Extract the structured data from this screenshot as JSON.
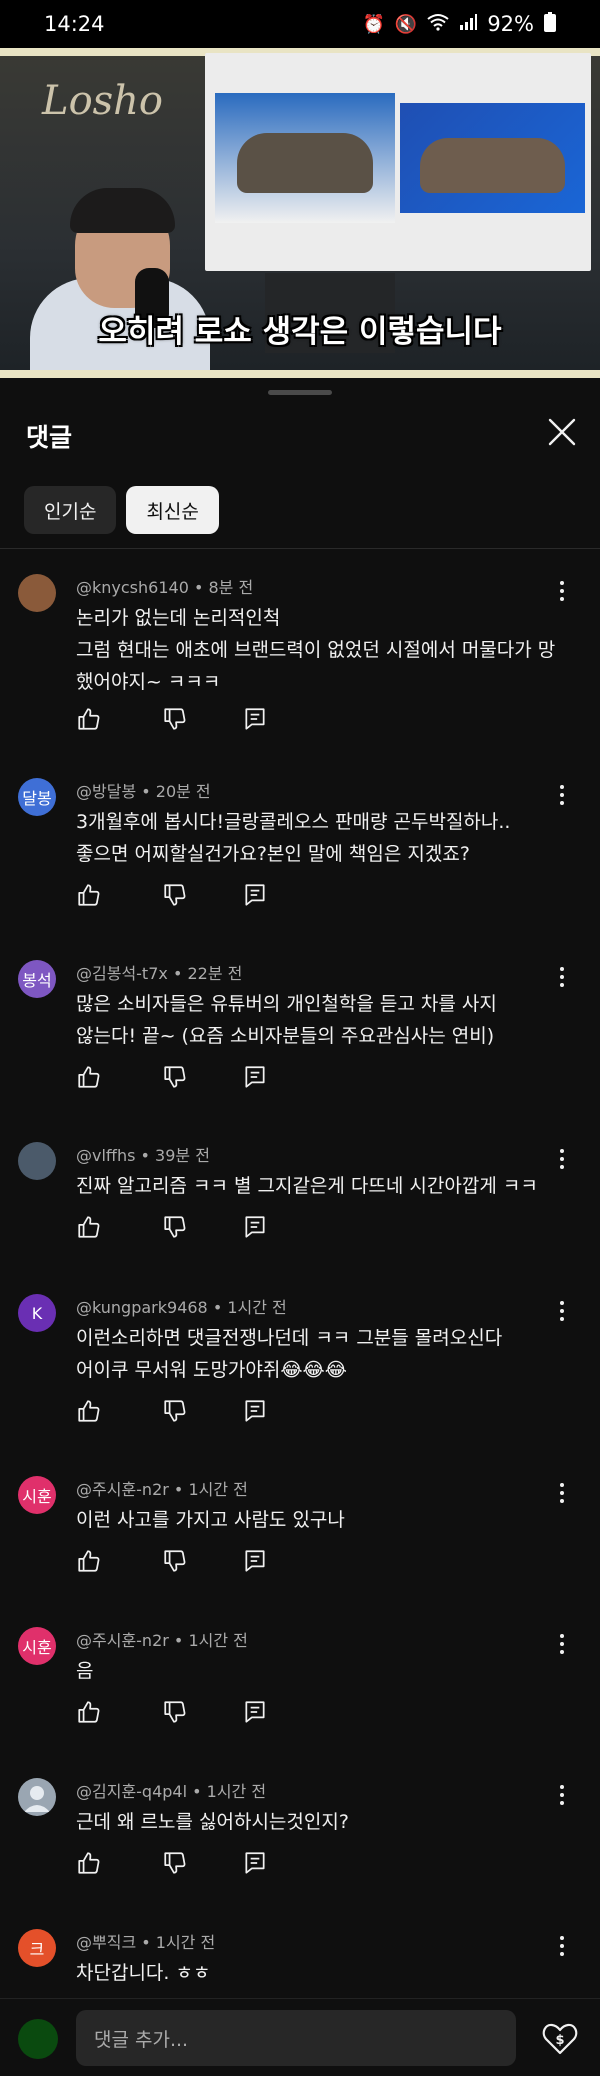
{
  "status": {
    "time": "14:24",
    "battery": "92%"
  },
  "video": {
    "logo": "Losho",
    "caption": "오히려 로쇼 생각은 이렇습니다"
  },
  "sheet": {
    "title": "댓글",
    "chips": [
      {
        "label": "인기순"
      },
      {
        "label": "최신순"
      }
    ],
    "selected_chip": "최신순"
  },
  "comments": [
    {
      "author": "@knycsh6140 • 8분 전",
      "text": "논리가 없는데 논리적인척\n그럼 현대는 애초에 브랜드력이 없었던 시절에서 머물다가 망했어야지~ ㅋㅋㅋ",
      "avatar_label": "",
      "avatar_color": "#8a5a3a"
    },
    {
      "author": "@방달봉 • 20분 전",
      "text": "3개월후에 봅시다!글랑콜레오스 판매량 곤두박질하나..\n좋으면 어찌할실건가요?본인 말에 책임은 지겠죠?",
      "avatar_label": "달봉",
      "avatar_color": "#3f6fd6"
    },
    {
      "author": "@김봉석-t7x • 22분 전",
      "text": "많은 소비자들은 유튜버의 개인철학을 듣고 차를 사지\n않는다!  끝~ (요즘 소비자분들의 주요관심사는 연비)",
      "avatar_label": "봉석",
      "avatar_color": "#7e57c2"
    },
    {
      "author": "@vlffhs • 39분 전",
      "text": "진짜 알고리즘 ㅋㅋ 별 그지같은게 다뜨네 시간아깝게 ㅋㅋ",
      "avatar_label": "",
      "avatar_color": "#4b5a6a"
    },
    {
      "author": "@kungpark9468 • 1시간 전",
      "text": "이런소리하면 댓글전쟁나던데 ㅋㅋ 그분들 몰려오신다\n어이쿠 무서워 도망가야쥐😂😂😂",
      "avatar_label": "K",
      "avatar_color": "#6a2fb3"
    },
    {
      "author": "@주시훈-n2r • 1시간 전",
      "text": "이런 사고를 가지고 사람도 있구나",
      "avatar_label": "시훈",
      "avatar_color": "#e0306b"
    },
    {
      "author": "@주시훈-n2r • 1시간 전",
      "text": "음",
      "avatar_label": "시훈",
      "avatar_color": "#e0306b"
    },
    {
      "author": "@김지훈-q4p4l • 1시간 전",
      "text": "근데 왜 르노를 싫어하시는것인지?",
      "avatar_label": "",
      "avatar_color": "#9aa6b2"
    },
    {
      "author": "@뿌직크 • 1시간 전",
      "text": "차단갑니다. ㅎㅎ",
      "avatar_label": "크",
      "avatar_color": "#e4502a"
    }
  ],
  "composer": {
    "placeholder": "댓글 추가..."
  },
  "colors": {
    "background": "#0f0f0f",
    "chip_active": "#f1f1f1",
    "text_secondary": "#aaaaaa"
  },
  "icons": [
    "like-icon",
    "dislike-icon",
    "reply-icon",
    "more-vert-icon",
    "close-icon",
    "super-thanks-icon"
  ]
}
